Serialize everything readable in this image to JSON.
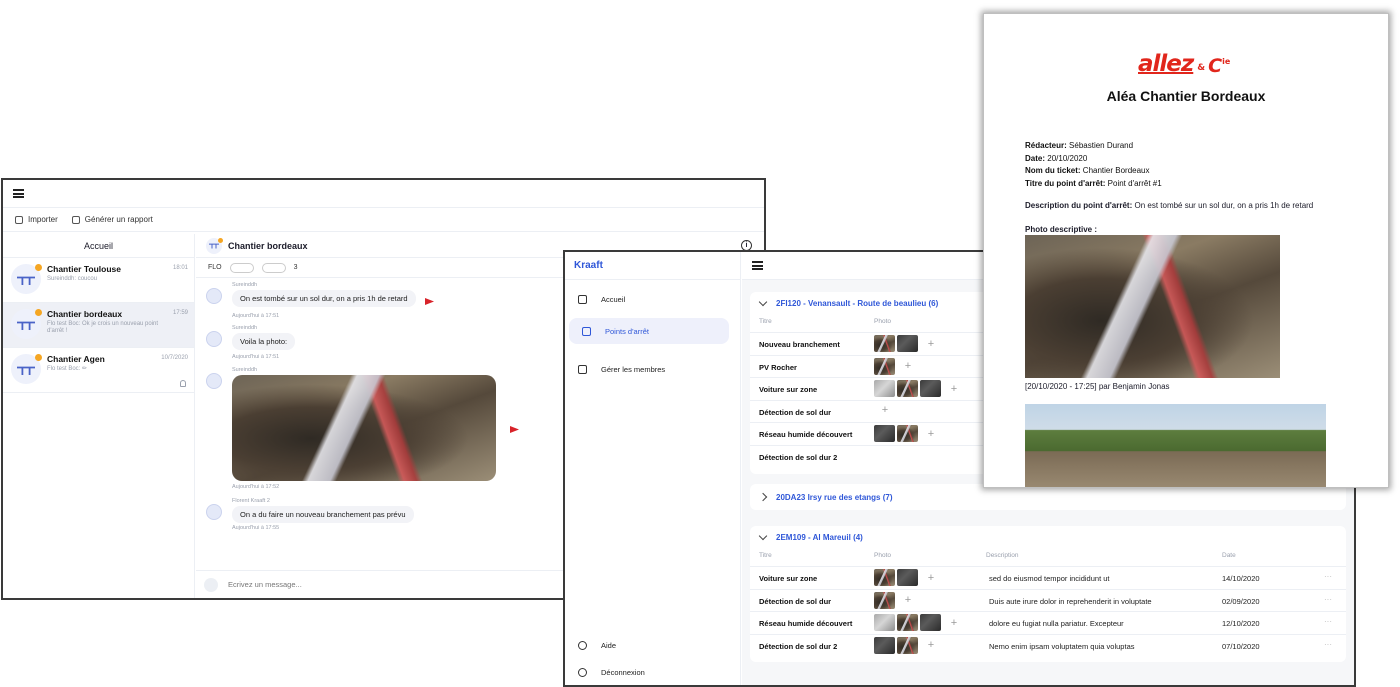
{
  "chat": {
    "toolbar": {
      "import": "Importer",
      "report": "Générer un rapport"
    },
    "sidebar_title": "Accueil",
    "conversations": [
      {
        "name": "Chantier Toulouse",
        "preview": "Sureinddh: coucou",
        "date": "18:01"
      },
      {
        "name": "Chantier bordeaux",
        "preview": "Flo test  Boc: Ok je crois un nouveau point d'arrêt !",
        "date": "17:59"
      },
      {
        "name": "Chantier Agen",
        "preview": "Flo test  Boc: ✏",
        "date": "10/7/2020"
      }
    ],
    "header_title": "Chantier bordeaux",
    "member_label": "FLO",
    "member_count": "3",
    "messages": [
      {
        "author": "Sureinddh",
        "text": "On est tombé sur un sol dur, on a pris 1h de retard",
        "time": "Aujourd'hui à 17:51"
      },
      {
        "author": "Sureinddh",
        "text": "Voila la photo:",
        "time": "Aujourd'hui à 17:51"
      },
      {
        "author": "Sureinddh",
        "text": "",
        "time": "Aujourd'hui à 17:52"
      },
      {
        "author": "Florent Kraaft 2",
        "text": "On a du faire un nouveau branchement pas prévu",
        "time": "Aujourd'hui à 17:55"
      }
    ],
    "composer_placeholder": "Ecrivez un message..."
  },
  "kraaft": {
    "brand": "Kraaft",
    "nav": {
      "home": "Accueil",
      "points": "Points d'arrêt",
      "members": "Gérer les membres",
      "help": "Aide",
      "logout": "Déconnexion"
    },
    "groups": [
      {
        "title": "2FI120 - Venansault - Route de beaulieu (6)",
        "col_title": "Titre",
        "col_photo": "Photo",
        "rows": [
          {
            "title": "Nouveau branchement",
            "photos": 2
          },
          {
            "title": "PV Rocher",
            "photos": 1
          },
          {
            "title": "Voiture sur zone",
            "photos": 3
          },
          {
            "title": "Détection de sol dur",
            "photos": 0
          },
          {
            "title": "Réseau humide découvert",
            "photos": 2
          },
          {
            "title": "Détection de sol dur 2",
            "photos": 0
          }
        ]
      },
      {
        "title": "20DA23 Irsy rue des etangs (7)"
      },
      {
        "title": "2EM109 - Al Mareuil (4)",
        "col_title": "Titre",
        "col_photo": "Photo",
        "col_desc": "Description",
        "col_date": "Date",
        "rows": [
          {
            "title": "Voiture sur zone",
            "desc": "sed do eiusmod tempor incididunt ut",
            "date": "14/10/2020",
            "photos": 2
          },
          {
            "title": "Détection de sol dur",
            "desc": "Duis aute irure dolor in reprehenderit in voluptate",
            "date": "02/09/2020",
            "photos": 1
          },
          {
            "title": "Réseau humide découvert",
            "desc": "dolore eu fugiat nulla pariatur. Excepteur",
            "date": "12/10/2020",
            "photos": 3
          },
          {
            "title": "Détection de sol dur 2",
            "desc": "Nemo enim ipsam voluptatem quia voluptas",
            "date": "07/10/2020",
            "photos": 2
          }
        ]
      }
    ]
  },
  "report": {
    "logo": {
      "main": "allez",
      "amp": "&",
      "cie": "C",
      "sup": "ie"
    },
    "title": "Aléa Chantier Bordeaux",
    "fields": [
      {
        "label": "Rédacteur:",
        "value": "Sébastien Durand"
      },
      {
        "label": "Date:",
        "value": "20/10/2020"
      },
      {
        "label": "Nom du ticket:",
        "value": "Chantier Bordeaux"
      },
      {
        "label": "Titre du point d'arrêt:",
        "value": "Point d'arrêt #1"
      }
    ],
    "description_label": "Description du point d'arrêt:",
    "description": "On est tombé sur un sol dur, on a pris 1h de retard",
    "photo_label": "Photo descriptive :",
    "photo_caption": "[20/10/2020 - 17:25] par Benjamin Jonas"
  },
  "colors": {
    "accent": "#2f57d8",
    "flag": "#d8232a",
    "logo": "#e1261c",
    "status_dot": "#f5a623"
  }
}
